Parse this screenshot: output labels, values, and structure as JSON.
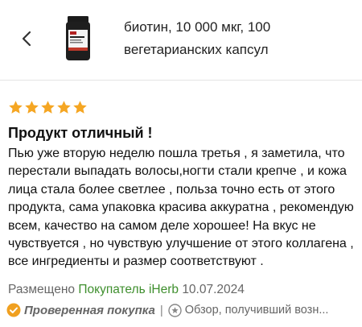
{
  "header": {
    "product_title": "биотин, 10 000 мкг, 100 вегетарианских капсул"
  },
  "review": {
    "rating": 5,
    "title": "Продукт отличный !",
    "body": "Пью уже вторую неделю пошла третья , я заметила, что перестали выпадать волосы,ногти стали крепче ,  и кожа лица стала более светлее , польза точно есть от этого продукта, сама упаковка красива аккуратна , рекомендую всем, качество на самом деле хорошее! На вкус не чувствуется , но чувствую улучшение от этого коллагена , все ингредиенты и размер соответствуют .",
    "posted_label": "Размещено",
    "author": "Покупатель iHerb",
    "date": "10.07.2024",
    "verified_label": "Проверенная покупка",
    "separator": "|",
    "badge_text": "Обзор, получивший возн..."
  },
  "colors": {
    "star": "#f5a623",
    "author_green": "#3f8f2e",
    "verified_orange": "#f0a020"
  }
}
